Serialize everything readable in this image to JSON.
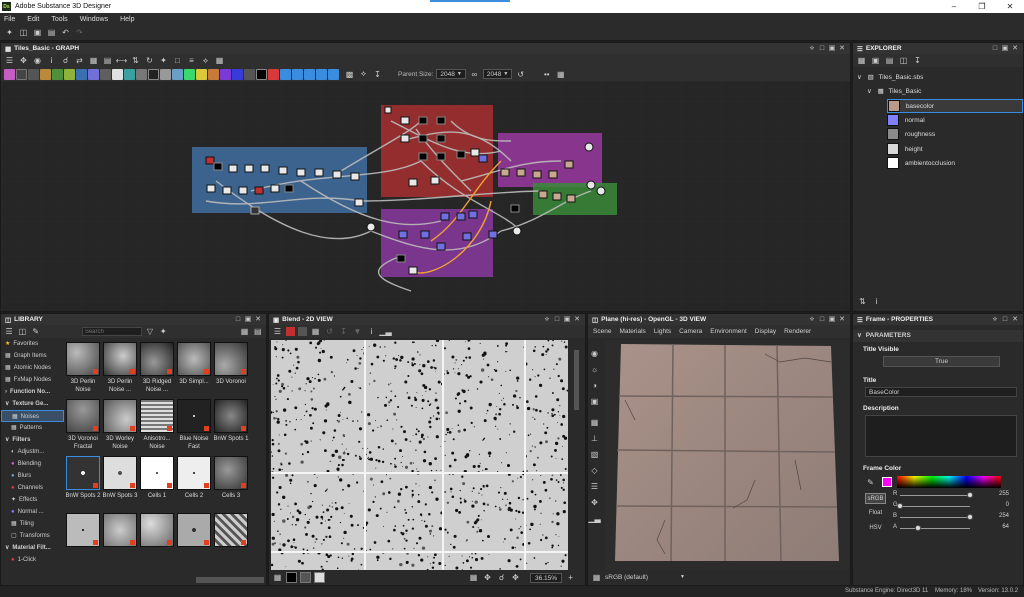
{
  "window": {
    "title": "Adobe Substance 3D Designer",
    "app_icon": "Ds"
  },
  "menu": [
    "File",
    "Edit",
    "Tools",
    "Windows",
    "Help"
  ],
  "graph": {
    "title": "Tiles_Basic - GRAPH",
    "parent_size_label": "Parent Size:",
    "parent_size": "2048",
    "size_value": "2048"
  },
  "explorer": {
    "title": "EXPLORER",
    "package": "Tiles_Basic.sbs",
    "graph": "Tiles_Basic",
    "outputs": [
      {
        "label": "basecolor",
        "color": "#b89b8d"
      },
      {
        "label": "normal",
        "color": "#8080ff"
      },
      {
        "label": "roughness",
        "color": "#8a8a8a"
      },
      {
        "label": "height",
        "color": "#d8d8d8"
      },
      {
        "label": "ambientocclusion",
        "color": "#ffffff"
      }
    ]
  },
  "library": {
    "title": "LIBRARY",
    "search_placeholder": "Search",
    "categories": [
      "Favorites",
      "Graph Items",
      "Atomic Nodes",
      "FxMap Nodes",
      "Function No...",
      "Texture Ge...",
      "Noises",
      "Patterns",
      "Filters",
      "Adjustm...",
      "Blending",
      "Blurs",
      "Channels",
      "Effects",
      "Normal ...",
      "Tiling",
      "Transforms",
      "Material Filt...",
      "1-Click"
    ],
    "items": [
      {
        "label": "3D Perlin Noise"
      },
      {
        "label": "3D Perlin Noise ..."
      },
      {
        "label": "3D Ridged Noise ..."
      },
      {
        "label": "3D Simpl..."
      },
      {
        "label": "3D Voronoi"
      },
      {
        "label": "3D Voronoi Fractal"
      },
      {
        "label": "3D Worley Noise"
      },
      {
        "label": "Anisotro... Noise"
      },
      {
        "label": "Blue Noise Fast"
      },
      {
        "label": "BnW Spots 1"
      },
      {
        "label": "BnW Spots 2"
      },
      {
        "label": "BnW Spots 3"
      },
      {
        "label": "Cells 1"
      },
      {
        "label": "Cells 2"
      },
      {
        "label": "Cells 3"
      },
      {
        "label": ""
      },
      {
        "label": ""
      },
      {
        "label": ""
      },
      {
        "label": ""
      },
      {
        "label": ""
      }
    ]
  },
  "view2d": {
    "title": "Blend - 2D VIEW",
    "zoom": "36.15%"
  },
  "view3d": {
    "title": "Plane (hi-res) - OpenGL - 3D VIEW",
    "menu": [
      "Scene",
      "Materials",
      "Lights",
      "Camera",
      "Environment",
      "Display",
      "Renderer"
    ],
    "colorspace": "sRGB (default)"
  },
  "properties": {
    "title": "Frame - PROPERTIES",
    "section": "PARAMETERS",
    "title_visible_label": "Title Visible",
    "title_visible_value": "True",
    "title_label": "Title",
    "title_value": "BaseColor",
    "description_label": "Description",
    "frame_color_label": "Frame Color",
    "frame_color": "#ff00ff",
    "modes": [
      "sRGB",
      "Float",
      "HSV"
    ],
    "channels": [
      {
        "name": "R",
        "value": "255",
        "fraction": 1.0
      },
      {
        "name": "G",
        "value": "0",
        "fraction": 0.0
      },
      {
        "name": "B",
        "value": "254",
        "fraction": 0.996
      },
      {
        "name": "A",
        "value": "64",
        "fraction": 0.25
      }
    ]
  },
  "status": {
    "engine": "Substance Engine: Direct3D 11",
    "memory": "Memory: 18%",
    "version": "Version: 13.0.2"
  }
}
